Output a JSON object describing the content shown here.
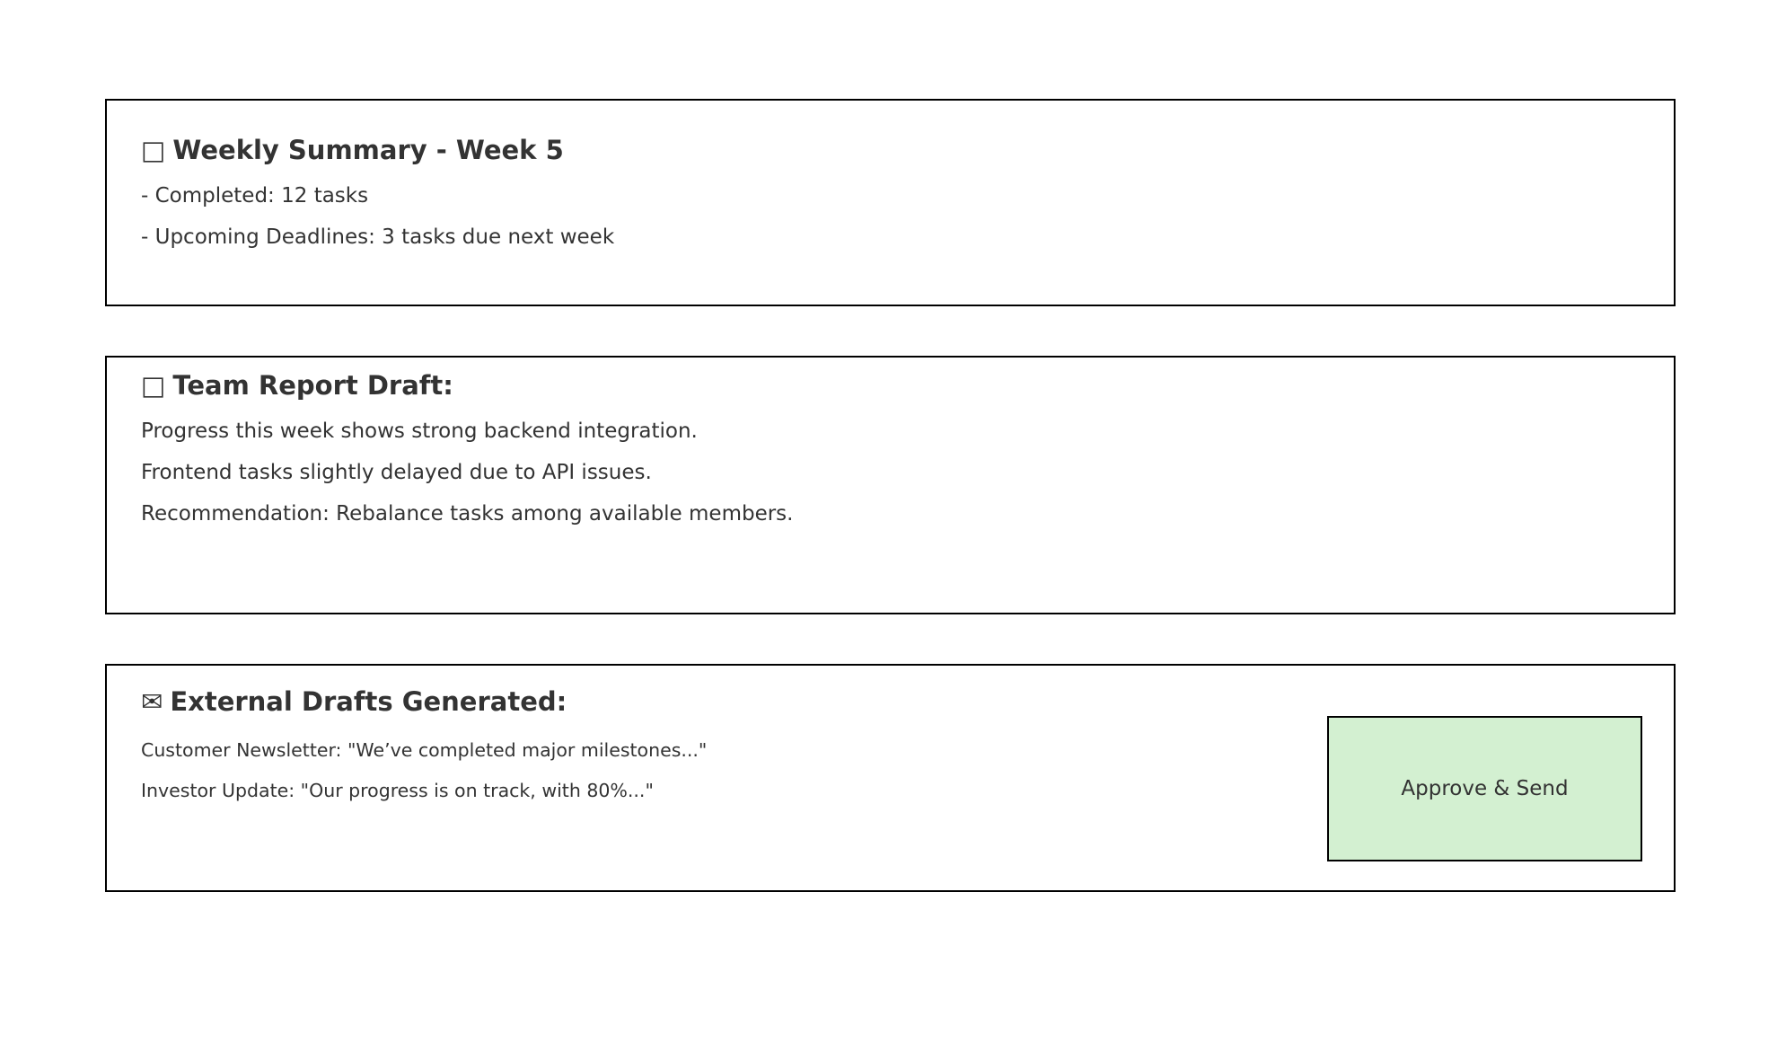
{
  "summary": {
    "icon": "calendar-icon",
    "icon_glyph": "□",
    "title": "Weekly Summary - Week 5",
    "lines": [
      "- Completed: 12 tasks",
      "- Upcoming Deadlines: 3 tasks due next week"
    ]
  },
  "report": {
    "icon": "memo-icon",
    "icon_glyph": "□",
    "title": "Team Report Draft:",
    "lines": [
      "Progress this week shows strong backend integration.",
      "Frontend tasks slightly delayed due to API issues.",
      "Recommendation: Rebalance tasks among available members."
    ]
  },
  "drafts": {
    "icon": "envelope-icon",
    "icon_glyph": "✉",
    "title": "External Drafts Generated:",
    "lines": [
      "Customer Newsletter: \"We’ve completed major milestones...\"",
      "Investor Update: \"Our progress is on track, with 80%...\""
    ],
    "approve_label": "Approve & Send",
    "approve_color": "#d3f0d1"
  }
}
